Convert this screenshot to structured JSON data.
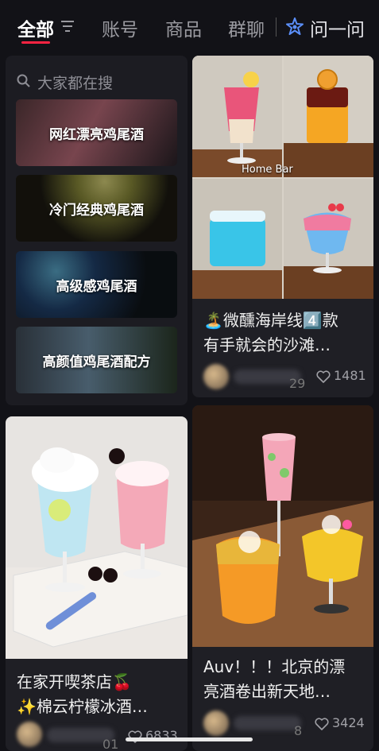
{
  "tabs": [
    {
      "label": "全部",
      "active": true
    },
    {
      "label": "账号"
    },
    {
      "label": "商品"
    },
    {
      "label": "群聊"
    },
    {
      "label": "问一问"
    }
  ],
  "accent_color": "#ff2442",
  "search_panel": {
    "header": "大家都在搜",
    "suggestions": [
      {
        "label": "网红漂亮鸡尾酒"
      },
      {
        "label": "冷门经典鸡尾酒"
      },
      {
        "label": "高级感鸡尾酒"
      },
      {
        "label": "高颜值鸡尾酒配方"
      }
    ]
  },
  "posts": [
    {
      "title_line1": "🏝️微醺海岸线4️⃣款",
      "title_line2": "有手就会的沙滩…",
      "likes": "1481",
      "image_text": "Home Bar",
      "author_suffix": "29"
    },
    {
      "title_line1": "在家开喫茶店🍒",
      "title_line2": "✨棉云柠檬冰酒…",
      "likes": "6833",
      "author_suffix": "01"
    },
    {
      "title_line1": "Auv！！！北京的漂",
      "title_line2": "亮酒卷出新天地…",
      "likes": "3424",
      "author_suffix": "8"
    }
  ],
  "icons": {
    "filter": "filter-lines-icon",
    "ask": "ask-sparkle-icon",
    "search": "search-icon",
    "like": "heart-outline-icon"
  }
}
